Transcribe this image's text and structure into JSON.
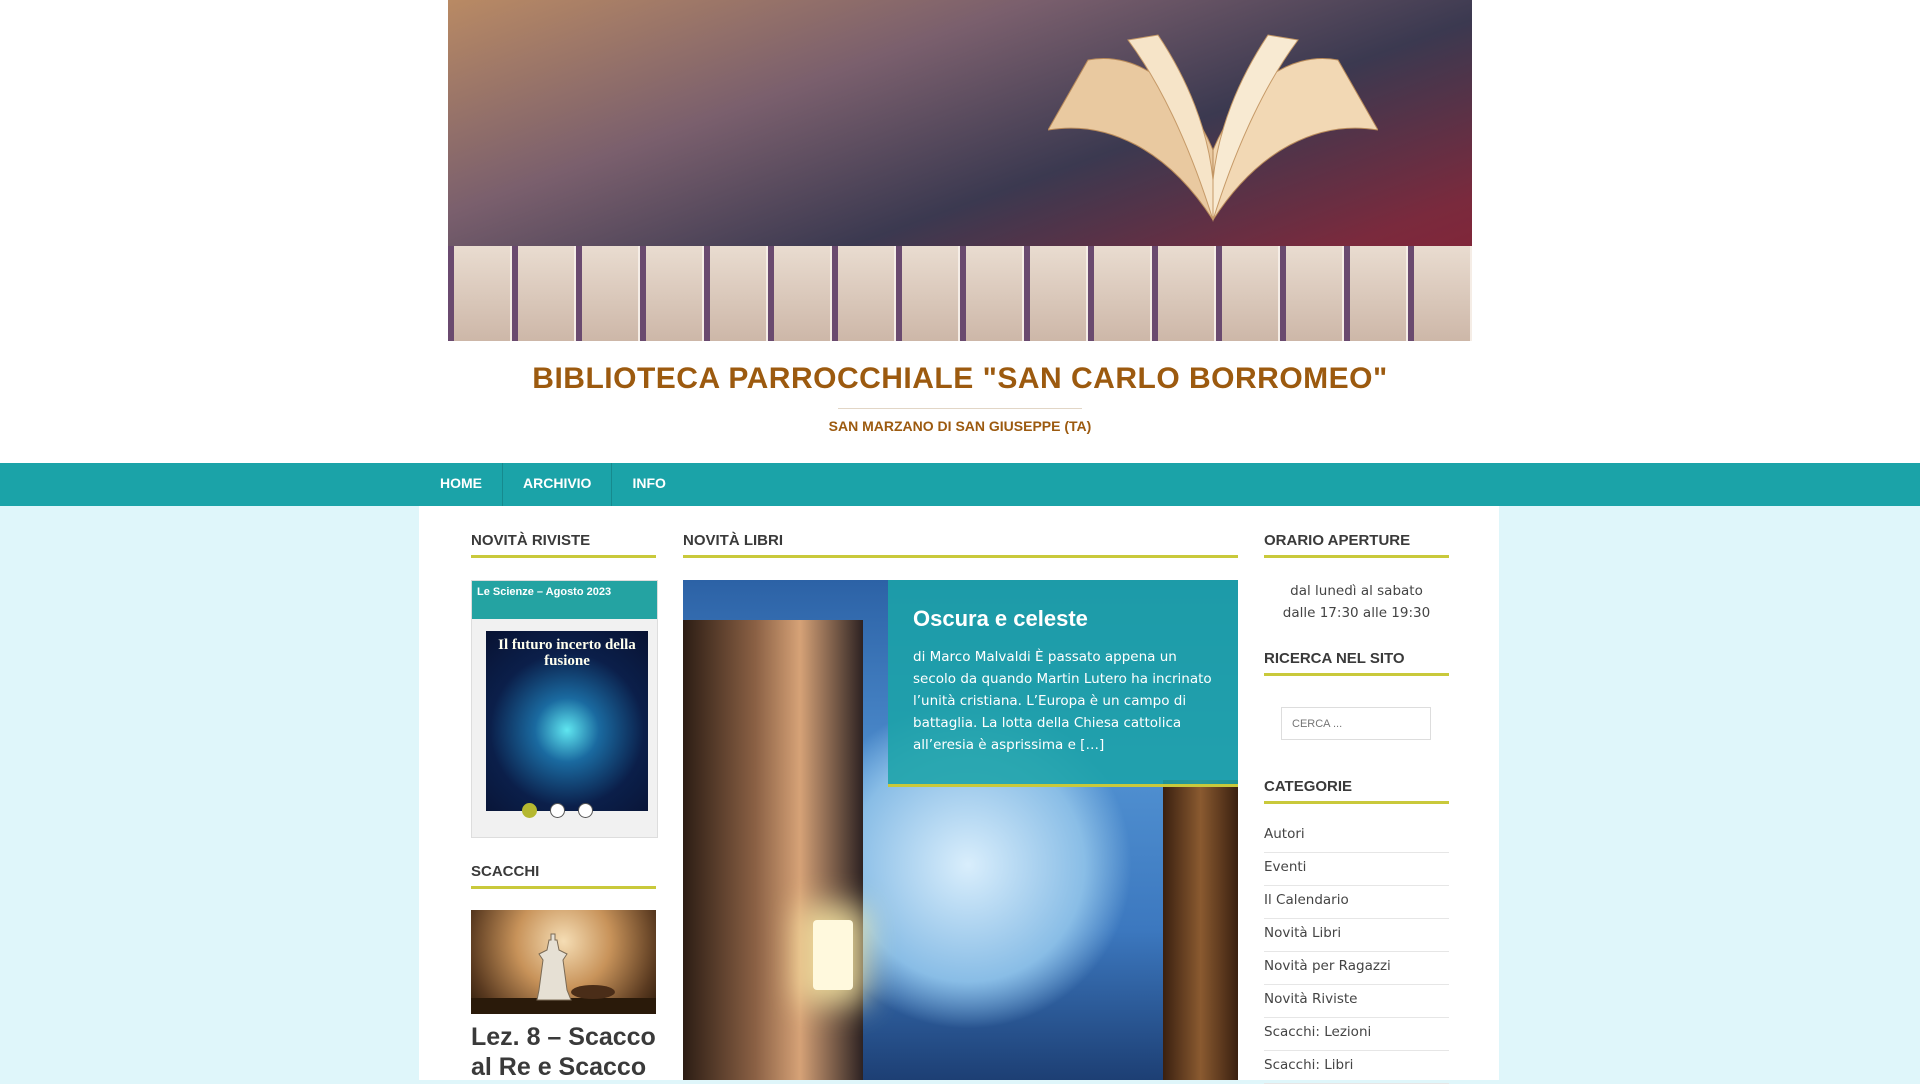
{
  "header": {
    "site_title": "BIBLIOTECA PARROCCHIALE \"SAN CARLO BORROMEO\"",
    "site_description": "SAN MARZANO DI SAN GIUSEPPE (TA)"
  },
  "nav": {
    "items": [
      {
        "label": "HOME"
      },
      {
        "label": "ARCHIVIO"
      },
      {
        "label": "INFO"
      }
    ]
  },
  "left": {
    "riviste_title": "NOVITÀ RIVISTE",
    "magazine_caption": "Le Scienze – Agosto 2023",
    "magazine_headline": "Il futuro incerto della fusione",
    "scacchi_title": "SCACCHI",
    "scacchi_post_title": "Lez. 8 – Scacco al Re e Scacco"
  },
  "middle": {
    "libri_title": "NOVITÀ LIBRI",
    "feature_title": "Oscura e celeste",
    "feature_excerpt": "di Marco Malvaldi È passato appena un secolo da quando Martin Lutero ha incrinato l’unità cristiana. L’Europa è un campo di battaglia. La lotta della Chiesa cattolica all’eresia è asprissima e […]"
  },
  "right": {
    "orario_title": "ORARIO APERTURE",
    "hours_line1": "dal lunedì al sabato",
    "hours_line2": "dalle 17:30 alle 19:30",
    "ricerca_title": "RICERCA NEL SITO",
    "search_placeholder": "CERCA ...",
    "categorie_title": "CATEGORIE",
    "categories": [
      {
        "label": "Autori"
      },
      {
        "label": "Eventi"
      },
      {
        "label": "Il Calendario"
      },
      {
        "label": "Novità Libri"
      },
      {
        "label": "Novità per Ragazzi"
      },
      {
        "label": "Novità Riviste"
      },
      {
        "label": "Scacchi: Lezioni"
      },
      {
        "label": "Scacchi: Libri"
      }
    ]
  },
  "colors": {
    "nav": "#1ba3a8",
    "title": "#9c5a0f",
    "accent": "#c9c93b",
    "page_bg": "#dff6fa"
  }
}
